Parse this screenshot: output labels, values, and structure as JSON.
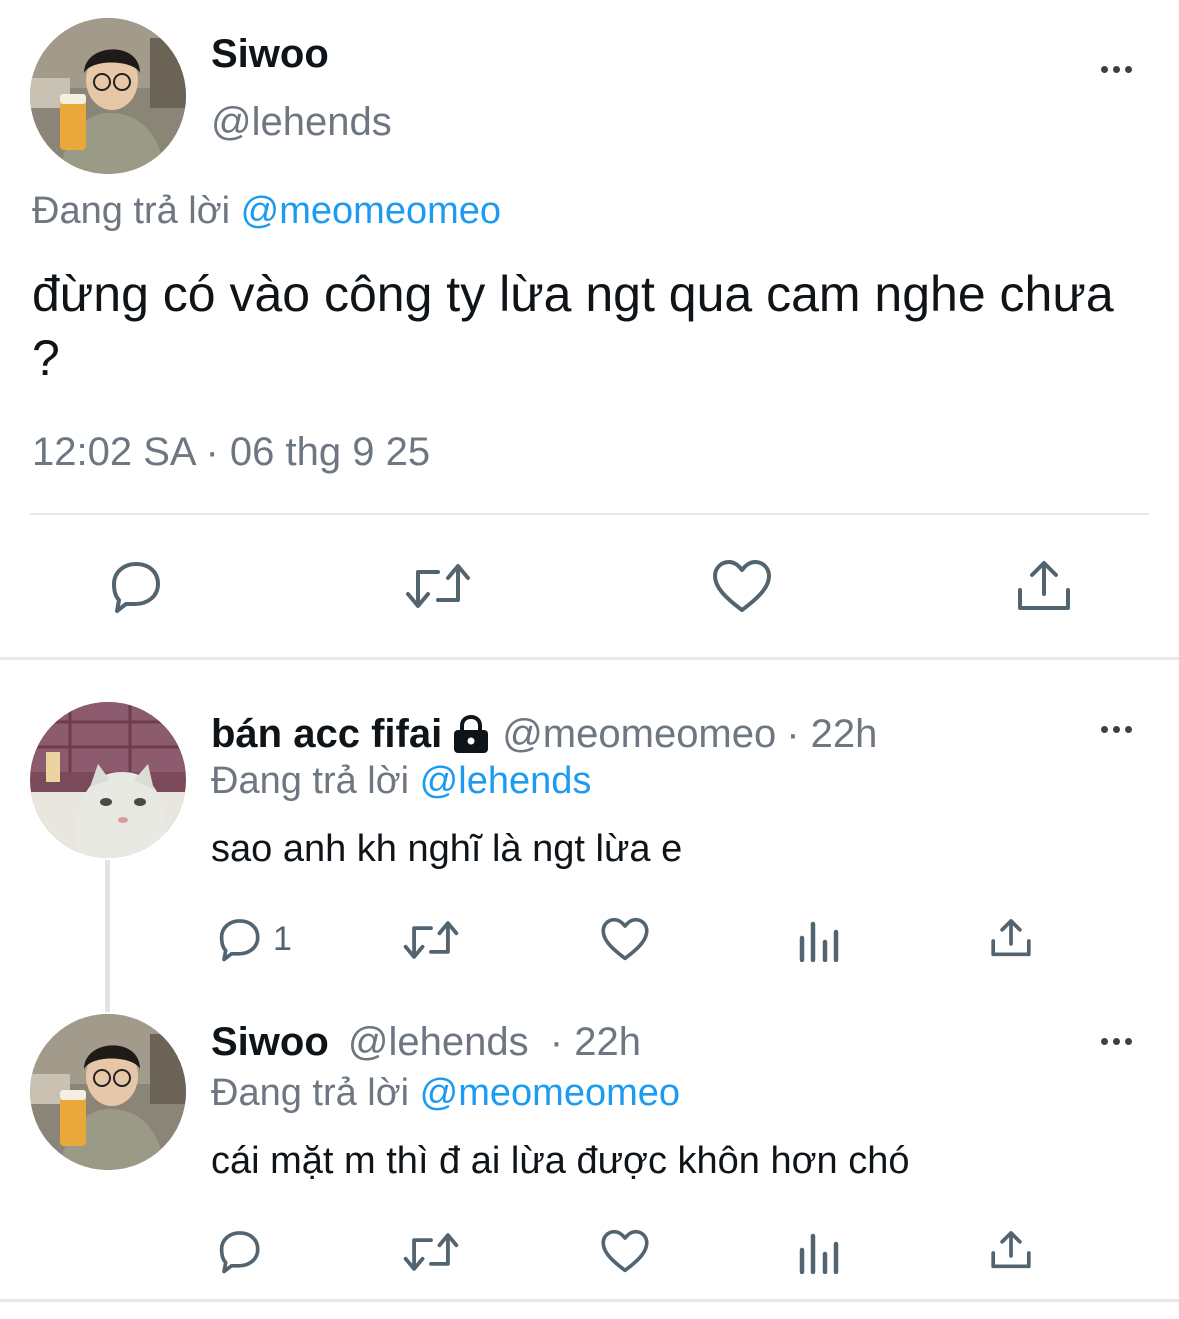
{
  "main_tweet": {
    "display_name": "Siwoo",
    "handle": "@lehends",
    "replying_prefix": "Đang trả lời",
    "replying_to": "@meomeomeo",
    "text": "đừng có vào công ty lừa ngt qua cam nghe chưa ?",
    "timestamp": "12:02 SA · 06 thg 9 25",
    "actions": [
      "reply-icon",
      "retweet-icon",
      "like-icon",
      "share-icon"
    ]
  },
  "replies": [
    {
      "display_name": "bán acc fifai",
      "lock_icon": "lock-icon",
      "handle": "@meomeomeo",
      "time": "· 22h",
      "replying_prefix": "Đang trả lời",
      "replying_to": "@lehends",
      "text": "sao anh kh nghĩ là ngt lừa e",
      "reply_count": "1"
    },
    {
      "display_name": "Siwoo",
      "handle": "@lehends",
      "time": "· 22h",
      "replying_prefix": "Đang trả lời",
      "replying_to": "@meomeomeo",
      "text": "cái mặt m thì đ ai lừa được khôn hơn chó",
      "reply_count": ""
    }
  ],
  "colors": {
    "link": "#1d9bf0",
    "muted": "#6e7781",
    "text": "#0f1419",
    "divider": "#e6e8ea"
  }
}
